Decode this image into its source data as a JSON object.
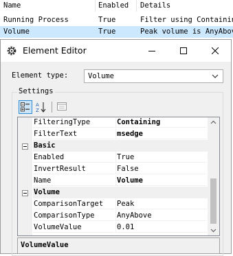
{
  "table": {
    "columns": [
      "Name",
      "Enabled",
      "Details"
    ],
    "rows": [
      {
        "name": "Running Process",
        "enabled": "True",
        "details": "Filter using Containin..."
      },
      {
        "name": "Volume",
        "enabled": "True",
        "details": "Peak volume is AnyAbov..."
      }
    ],
    "selected_row_color": "#cce8ff"
  },
  "dialog": {
    "title": "Element Editor",
    "icons": {
      "app": "gear-icon",
      "minimize": "minimize-icon",
      "maximize": "maximize-icon",
      "close": "close-icon"
    },
    "element_type_label": "Element type:",
    "element_type_value": "Volume",
    "settings_label": "Settings",
    "toolbar": {
      "categorized": "categorized-icon",
      "alphabetical": "sort-az-icon",
      "property_pages": "property-pages-icon"
    },
    "properties": {
      "rows": [
        {
          "name": "FilteringType",
          "value": "Containing",
          "bold": true
        },
        {
          "name": "FilterText",
          "value": "msedge",
          "bold": true
        },
        {
          "category": "Basic"
        },
        {
          "name": "Enabled",
          "value": "True",
          "bold": false
        },
        {
          "name": "InvertResult",
          "value": "False",
          "bold": false
        },
        {
          "name": "Name",
          "value": "Volume",
          "bold": true
        },
        {
          "category": "Volume"
        },
        {
          "name": "ComparisonTarget",
          "value": "Peak",
          "bold": false
        },
        {
          "name": "ComparisonType",
          "value": "AnyAbove",
          "bold": false
        },
        {
          "name": "VolumeValue",
          "value": "0.01",
          "bold": false
        }
      ]
    },
    "description_title": "VolumeValue"
  }
}
